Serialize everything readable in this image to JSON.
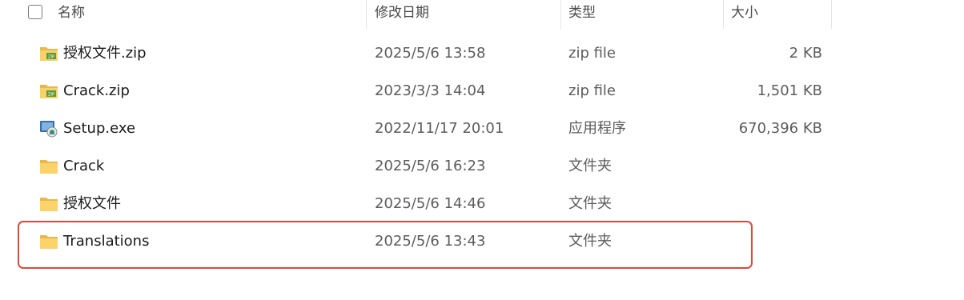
{
  "header": {
    "name": "名称",
    "date": "修改日期",
    "type": "类型",
    "size": "大小"
  },
  "files": [
    {
      "name": "授权文件.zip",
      "date": "2025/5/6 13:58",
      "type": "zip file",
      "size": "2 KB",
      "icon": "zip-folder-icon"
    },
    {
      "name": "Crack.zip",
      "date": "2023/3/3 14:04",
      "type": "zip file",
      "size": "1,501 KB",
      "icon": "zip-folder-icon"
    },
    {
      "name": "Setup.exe",
      "date": "2022/11/17 20:01",
      "type": "应用程序",
      "size": "670,396 KB",
      "icon": "installer-icon"
    },
    {
      "name": "Crack",
      "date": "2025/5/6 16:23",
      "type": "文件夹",
      "size": "",
      "icon": "folder-icon"
    },
    {
      "name": "授权文件",
      "date": "2025/5/6 14:46",
      "type": "文件夹",
      "size": "",
      "icon": "folder-icon"
    },
    {
      "name": "Translations",
      "date": "2025/5/6 13:43",
      "type": "文件夹",
      "size": "",
      "icon": "folder-icon"
    }
  ],
  "highlight_color": "#e0483a"
}
